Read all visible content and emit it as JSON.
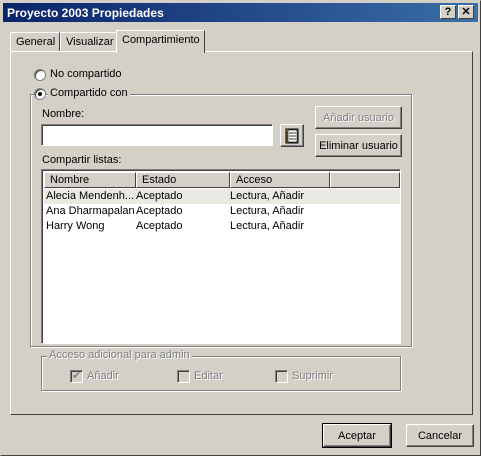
{
  "window": {
    "title": "Proyecto 2003 Propiedades",
    "help_btn": "?",
    "close_btn": "✕"
  },
  "tabs": [
    {
      "label": "General"
    },
    {
      "label": "Visualizar"
    },
    {
      "label": "Compartimiento",
      "active": true
    }
  ],
  "sharing": {
    "not_shared_label": "No compartido",
    "shared_with_label": "Compartido con",
    "selected": "shared_with"
  },
  "name_field": {
    "label": "Nombre:",
    "value": "",
    "address_book_icon": "address-book-icon"
  },
  "buttons": {
    "add_user": "Añadir usuario",
    "remove_user": "Eliminar usuario",
    "ok": "Aceptar",
    "cancel": "Cancelar"
  },
  "shared_lists": {
    "label": "Compartir listas:",
    "columns": [
      "Nombre",
      "Estado",
      "Acceso"
    ],
    "rows": [
      {
        "name": "Alecia Mendenh...",
        "status": "Aceptado",
        "access": "Lectura, Añadir"
      },
      {
        "name": "Ana Dharmapalan",
        "status": "Aceptado",
        "access": "Lectura, Añadir"
      },
      {
        "name": "Harry Wong",
        "status": "Aceptado",
        "access": "Lectura, Añadir"
      }
    ]
  },
  "admin_access": {
    "label": "Acceso adicional para admin",
    "options": [
      {
        "label": "Añadir",
        "checked": true
      },
      {
        "label": "Editar",
        "checked": false
      },
      {
        "label": "Suprimir",
        "checked": false
      }
    ]
  }
}
